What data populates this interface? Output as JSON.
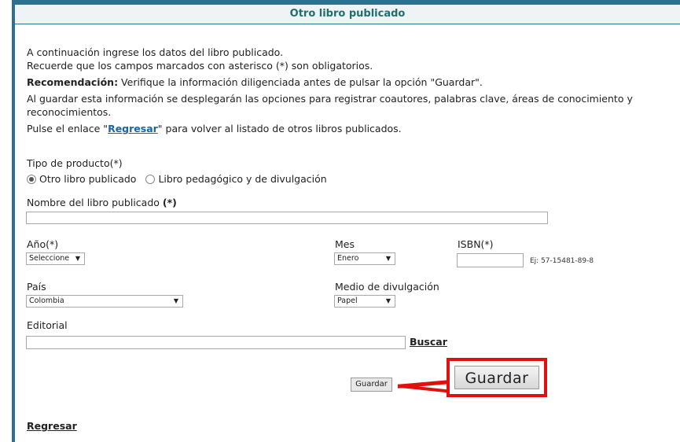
{
  "header": {
    "title": "Otro libro publicado"
  },
  "intro": {
    "line1": "A continuación ingrese los datos del libro publicado.",
    "line2": "Recuerde que los campos marcados con asterisco (*) son obligatorios.",
    "rec_label": "Recomendación:",
    "rec_text": " Verifique la información diligenciada antes de pulsar la opción \"Guardar\".",
    "line4": "Al guardar esta información se desplegarán las opciones para registrar coautores, palabras clave, áreas de conocimiento y reconocimientos.",
    "line5_pre": "Pulse el enlace \"",
    "line5_link": "Regresar",
    "line5_post": "\" para volver al listado de otros libros publicados."
  },
  "form": {
    "tipo_label": "Tipo de producto(*)",
    "tipo_options": [
      "Otro libro publicado",
      "Libro pedagógico y de divulgación"
    ],
    "nombre_label": "Nombre del libro publicado",
    "nombre_req": "(*)",
    "ano_label": "Año(*)",
    "ano_value": "Seleccione",
    "mes_label": "Mes",
    "mes_value": "Enero",
    "isbn_label": "ISBN(*)",
    "isbn_hint": "Ej: 57-15481-89-8",
    "pais_label": "País",
    "pais_value": "Colombia",
    "medio_label": "Medio de divulgación",
    "medio_value": "Papel",
    "editorial_label": "Editorial",
    "buscar_label": "Buscar",
    "guardar_label": "Guardar",
    "guardar_callout": "Guardar"
  },
  "footer": {
    "regresar_label": "Regresar"
  },
  "colors": {
    "accent": "#2f6f8f",
    "title": "#1f6f6f",
    "link": "#1765a8",
    "callout": "#e01010"
  }
}
